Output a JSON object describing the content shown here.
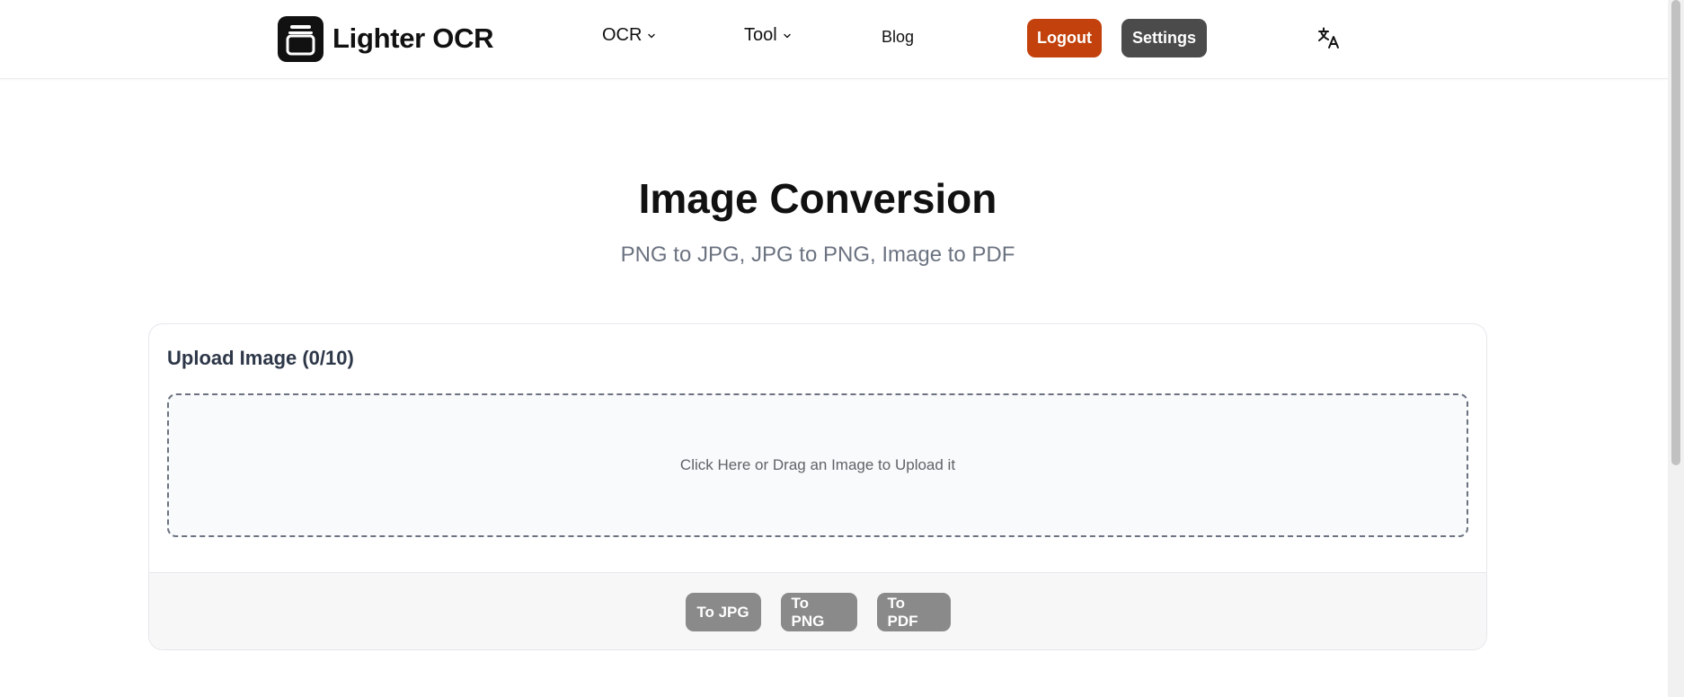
{
  "header": {
    "brand": {
      "name": "Lighter OCR",
      "logo_icon": "jar-icon"
    },
    "nav": [
      {
        "label": "OCR",
        "has_dropdown": true
      },
      {
        "label": "Tool",
        "has_dropdown": true
      },
      {
        "label": "Blog",
        "has_dropdown": false
      }
    ],
    "logout_label": "Logout",
    "settings_label": "Settings",
    "translate_icon": "translate-icon"
  },
  "main": {
    "title": "Image Conversion",
    "subtitle": "PNG to JPG, JPG to PNG, Image to PDF",
    "upload": {
      "title": "Upload Image (0/10)",
      "dropzone_text": "Click Here or Drag an Image to Upload it"
    },
    "actions": [
      {
        "label": "To JPG"
      },
      {
        "label": "To PNG"
      },
      {
        "label": "To PDF"
      }
    ]
  },
  "colors": {
    "logout": "#c2410c",
    "settings": "#4b4b4b",
    "action_button": "#8a8a8a",
    "brand": "#111111"
  }
}
